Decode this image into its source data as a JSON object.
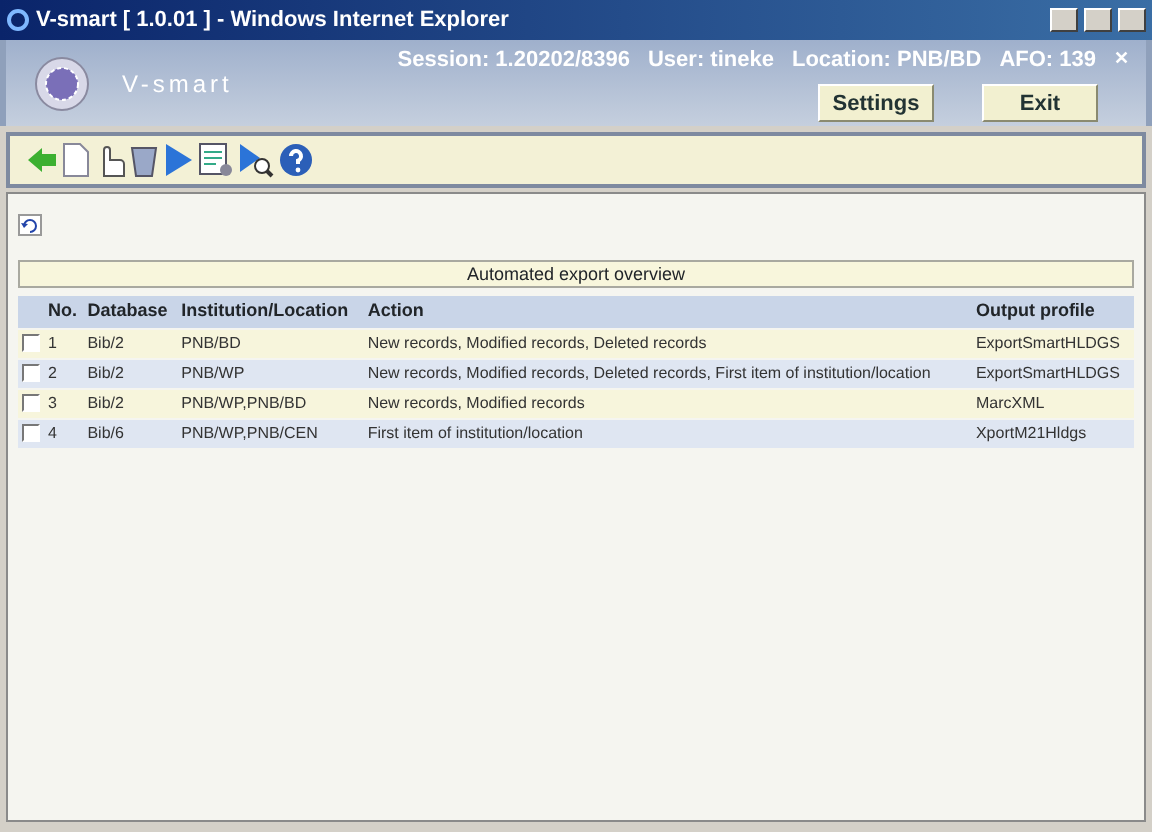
{
  "window": {
    "title": "V-smart [ 1.0.01 ] - Windows Internet Explorer"
  },
  "header": {
    "app_name": "V-smart",
    "session": "Session: 1.20202/8396",
    "user": "User: tineke",
    "location": "Location: PNB/BD",
    "afo": "AFO: 139",
    "close": "✕",
    "buttons": [
      "Settings",
      "Exit"
    ]
  },
  "panel": {
    "title": "Automated export overview"
  },
  "table": {
    "columns": [
      "No.",
      "Database",
      "Institution/Location",
      "Action",
      "Output profile"
    ],
    "rows": [
      {
        "checked": false,
        "cells": [
          "1",
          "Bib/2",
          "PNB/BD",
          "New records, Modified records, Deleted records",
          "ExportSmartHLDGS"
        ]
      },
      {
        "checked": false,
        "cells": [
          "2",
          "Bib/2",
          "PNB/WP",
          "New records, Modified records, Deleted records, First item of institution/location",
          "ExportSmartHLDGS"
        ]
      },
      {
        "checked": false,
        "cells": [
          "3",
          "Bib/2",
          "PNB/WP,PNB/BD",
          "New records, Modified records",
          "MarcXML"
        ]
      },
      {
        "checked": false,
        "cells": [
          "4",
          "Bib/6",
          "PNB/WP,PNB/CEN",
          "First item of institution/location",
          "XportM21Hldgs"
        ]
      }
    ]
  }
}
